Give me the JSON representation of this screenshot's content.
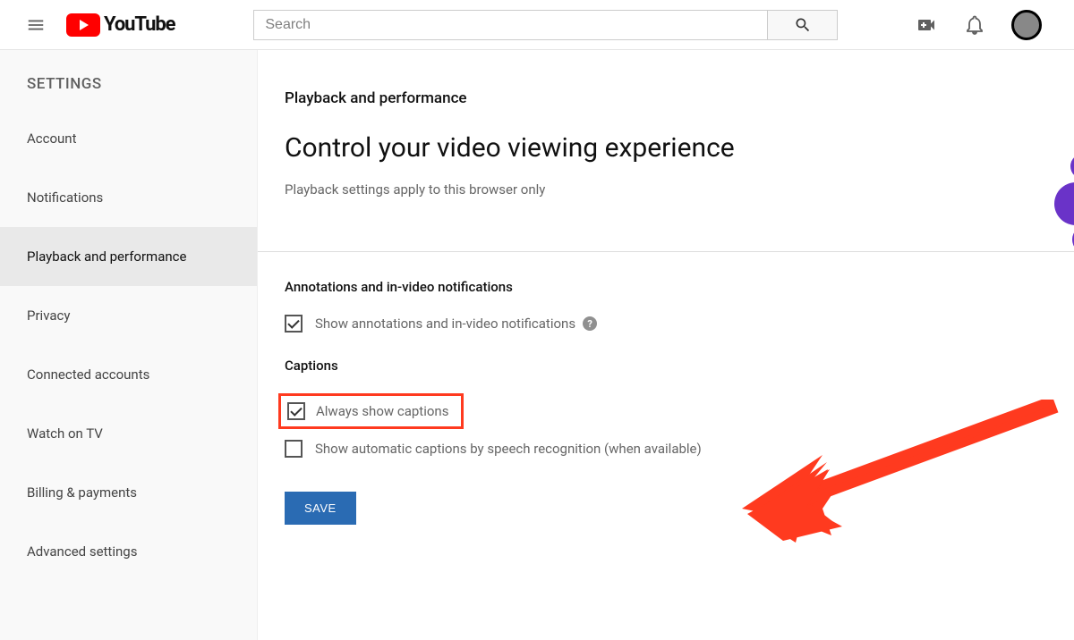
{
  "header": {
    "logo_text": "YouTube",
    "search_placeholder": "Search"
  },
  "sidebar": {
    "title": "SETTINGS",
    "items": [
      {
        "label": "Account"
      },
      {
        "label": "Notifications"
      },
      {
        "label": "Playback and performance"
      },
      {
        "label": "Privacy"
      },
      {
        "label": "Connected accounts"
      },
      {
        "label": "Watch on TV"
      },
      {
        "label": "Billing & payments"
      },
      {
        "label": "Advanced settings"
      }
    ],
    "active_index": 2
  },
  "main": {
    "section_label": "Playback and performance",
    "title": "Control your video viewing experience",
    "subtitle": "Playback settings apply to this browser only",
    "annotations": {
      "heading": "Annotations and in-video notifications",
      "checkbox_label": "Show annotations and in-video notifications",
      "checked": true
    },
    "captions": {
      "heading": "Captions",
      "always_label": "Always show captions",
      "always_checked": true,
      "auto_label": "Show automatic captions by speech recognition (when available)",
      "auto_checked": false
    },
    "save_label": "SAVE",
    "help_glyph": "?"
  }
}
